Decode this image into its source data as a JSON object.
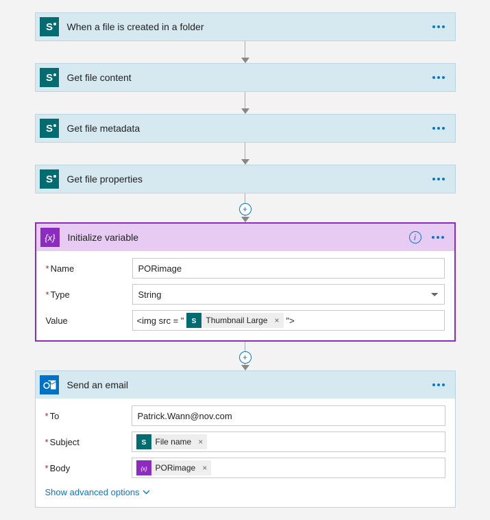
{
  "triggers": [
    {
      "title": "When a file is created in a folder",
      "connector": "sharepoint"
    }
  ],
  "actions": [
    {
      "title": "Get file content",
      "connector": "sharepoint",
      "collapsed": true
    },
    {
      "title": "Get file metadata",
      "connector": "sharepoint",
      "collapsed": true
    },
    {
      "title": "Get file properties",
      "connector": "sharepoint",
      "collapsed": true
    },
    {
      "title": "Initialize variable",
      "connector": "variable",
      "collapsed": false,
      "fields": {
        "name": {
          "label": "Name",
          "required": true,
          "value": "PORimage"
        },
        "type": {
          "label": "Type",
          "required": true,
          "value": "String"
        },
        "value": {
          "label": "Value",
          "required": false,
          "parts": [
            {
              "kind": "text",
              "value": "<img src = \""
            },
            {
              "kind": "token",
              "source": "sharepoint",
              "label": "Thumbnail Large"
            },
            {
              "kind": "text",
              "value": "\">"
            }
          ]
        }
      }
    },
    {
      "title": "Send an email",
      "connector": "outlook",
      "collapsed": false,
      "fields": {
        "to": {
          "label": "To",
          "required": true,
          "value": "Patrick.Wann@nov.com"
        },
        "subject": {
          "label": "Subject",
          "required": true,
          "parts": [
            {
              "kind": "token",
              "source": "sharepoint",
              "label": "File name"
            }
          ]
        },
        "body": {
          "label": "Body",
          "required": true,
          "parts": [
            {
              "kind": "token",
              "source": "variable",
              "label": "PORimage"
            }
          ]
        }
      },
      "advanced_link": "Show advanced options"
    }
  ],
  "ui": {
    "token_close": "×",
    "add_step": "+"
  }
}
